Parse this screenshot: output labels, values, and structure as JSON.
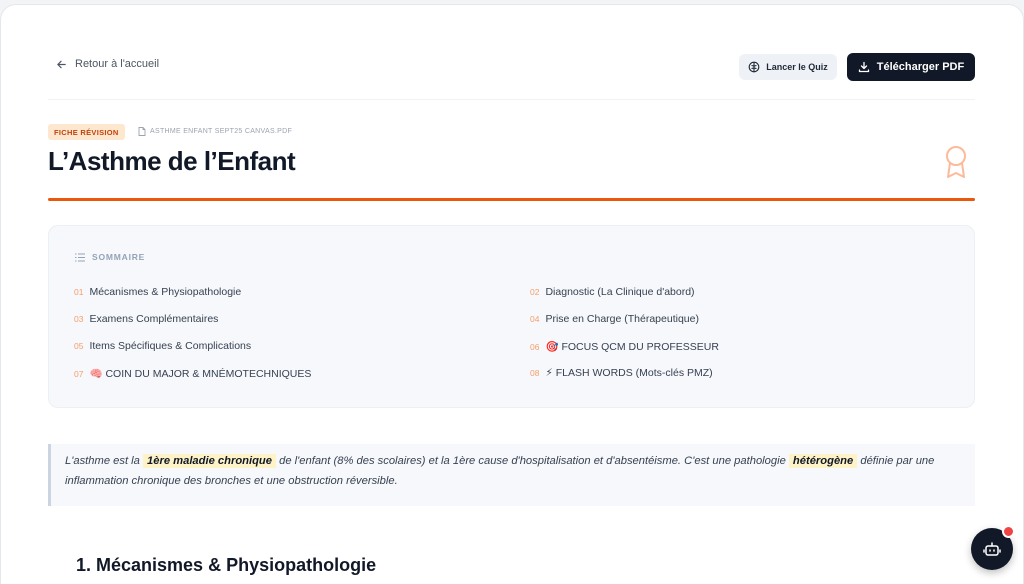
{
  "nav": {
    "back_label": "Retour à l'accueil",
    "quiz_label": "Lancer le Quiz",
    "pdf_label": "Télécharger PDF"
  },
  "header": {
    "badge": "FICHE RÉVISION",
    "file_name": "ASTHME ENFANT SEPT25 CANVAS.PDF",
    "title": "L’Asthme de l’Enfant"
  },
  "summary": {
    "title": "SOMMAIRE",
    "items": [
      {
        "num": "01",
        "label": "Mécanismes & Physiopathologie"
      },
      {
        "num": "02",
        "label": "Diagnostic (La Clinique d'abord)"
      },
      {
        "num": "03",
        "label": "Examens Complémentaires"
      },
      {
        "num": "04",
        "label": "Prise en Charge (Thérapeutique)"
      },
      {
        "num": "05",
        "label": "Items Spécifiques & Complications"
      },
      {
        "num": "06",
        "label": "🎯 FOCUS QCM DU PROFESSEUR"
      },
      {
        "num": "07",
        "label": "🧠 COIN DU MAJOR & MNÉMOTECHNIQUES"
      },
      {
        "num": "08",
        "label": "⚡ FLASH WORDS (Mots-clés PMZ)"
      }
    ]
  },
  "intro": {
    "part1": "L'asthme est la ",
    "highlight1": "1ère maladie chronique",
    "part2": " de l'enfant (8% des scolaires) et la 1ère cause d'hospitalisation et d'absentéisme. C'est une pathologie ",
    "highlight2": "hétérogène",
    "part3": " définie par une inflammation chronique des bronches et une obstruction réversible."
  },
  "section": {
    "title": "1. Mécanismes & Physiopathologie"
  },
  "colors": {
    "accent": "#ea580c",
    "dark": "#111827",
    "highlight": "#fef3c7",
    "notification": "#ef4444"
  },
  "icons": [
    "arrow-left-icon",
    "brain-icon",
    "download-icon",
    "file-icon",
    "award-icon",
    "list-icon",
    "bot-icon"
  ]
}
